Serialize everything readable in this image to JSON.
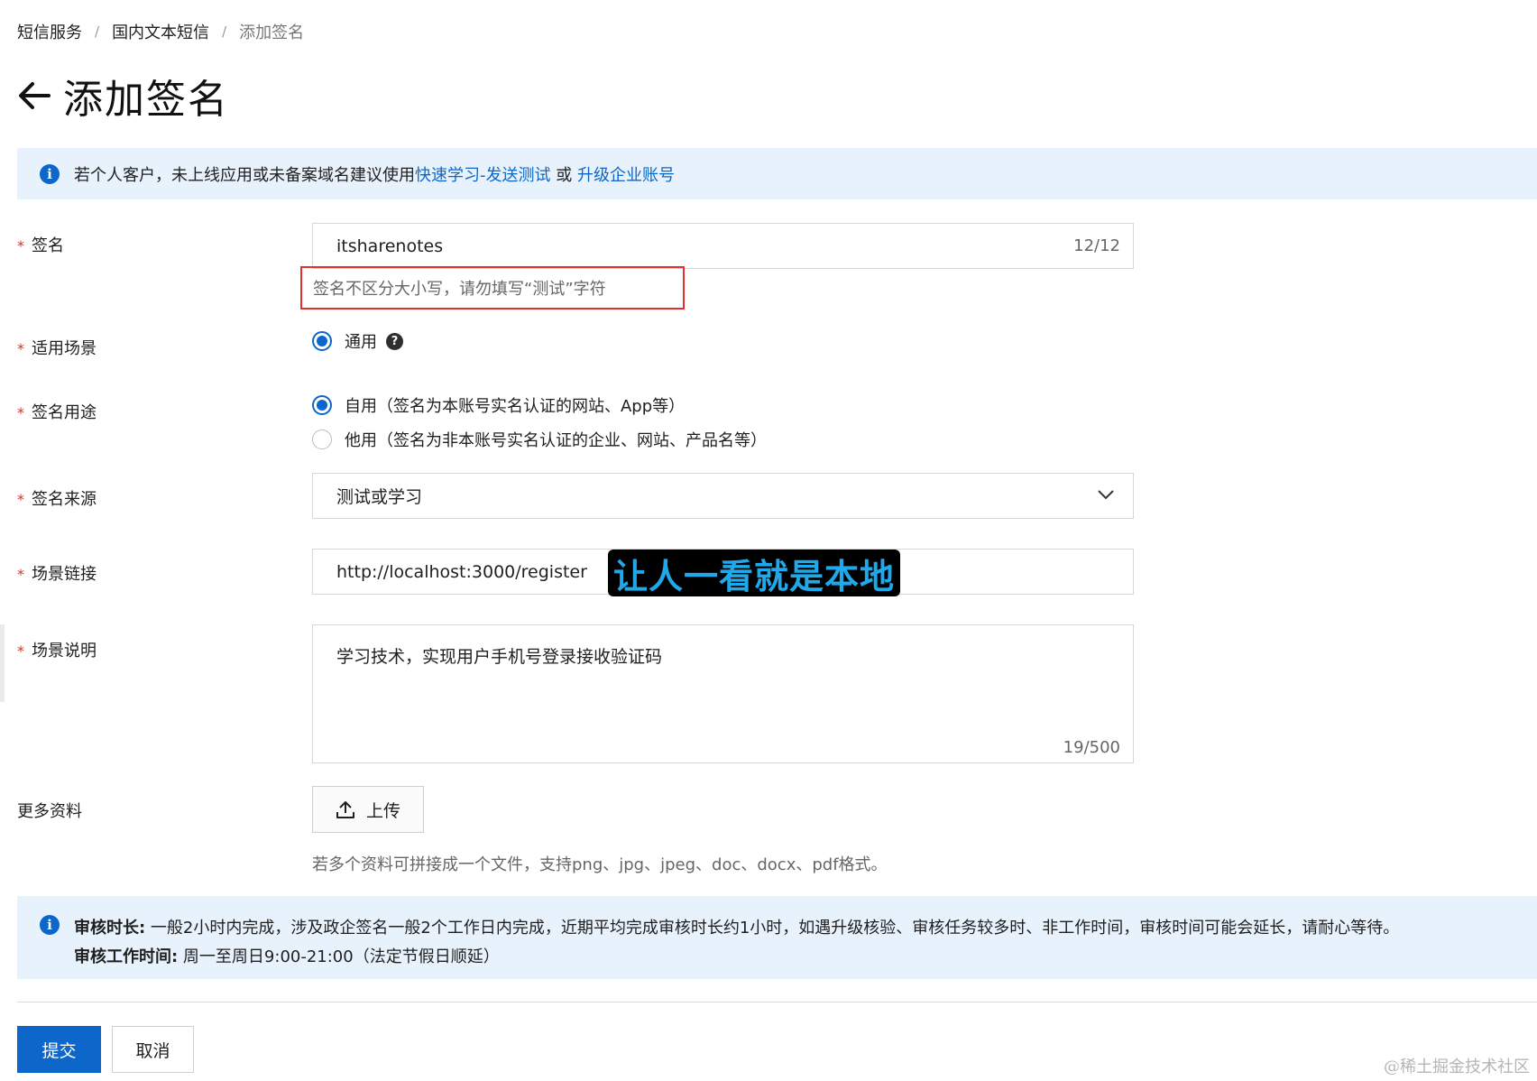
{
  "breadcrumb": {
    "item1": "短信服务",
    "item2": "国内文本短信",
    "current": "添加签名",
    "separator": "/"
  },
  "page": {
    "title": "添加签名"
  },
  "notice_top": {
    "text": "若个人客户，未上线应用或未备案域名建议使用",
    "link1": "快速学习-发送测试",
    "conj": " 或 ",
    "link2": "升级企业账号",
    "icon": "info-icon"
  },
  "form": {
    "required_mark": "*",
    "signature": {
      "label": "签名",
      "value": "itsharenotes",
      "counter": "12/12",
      "hint": "签名不区分大小写，请勿填写“测试”字符"
    },
    "scene": {
      "label": "适用场景",
      "option": "通用",
      "help": "?"
    },
    "usage": {
      "label": "签名用途",
      "option_self": "自用（签名为本账号实名认证的网站、App等）",
      "option_other": "他用（签名为非本账号实名认证的企业、网站、产品名等）",
      "selected": "自用"
    },
    "source": {
      "label": "签名来源",
      "value": "测试或学习"
    },
    "scene_link": {
      "label": "场景链接",
      "value": "http://localhost:3000/register"
    },
    "scene_desc": {
      "label": "场景说明",
      "value": "学习技术，实现用户手机号登录接收验证码",
      "counter": "19/500"
    },
    "more_materials": {
      "label": "更多资料",
      "upload_label": "上传",
      "hint": "若多个资料可拼接成一个文件，支持png、jpg、jpeg、doc、docx、pdf格式。"
    }
  },
  "annotation": {
    "text": "让人一看就是本地"
  },
  "notice_bottom": {
    "line1_bold": "审核时长:",
    "line1_text": " 一般2小时内完成，涉及政企签名一般2个工作日内完成，近期平均完成审核时长约1小时，如遇升级核验、审核任务较多时、非工作时间，审核时间可能会延长，请耐心等待。",
    "line2_bold": "审核工作时间:",
    "line2_text": " 周一至周日9:00-21:00（法定节假日顺延）"
  },
  "actions": {
    "submit": "提交",
    "cancel": "取消"
  },
  "watermark": "@稀土掘金技术社区",
  "colors": {
    "primary": "#0d66c9",
    "notice_bg": "#e8f2fd",
    "required": "#d0362d",
    "annotation_box": "#e0312e",
    "annotation_text": "#1fa9ea"
  }
}
